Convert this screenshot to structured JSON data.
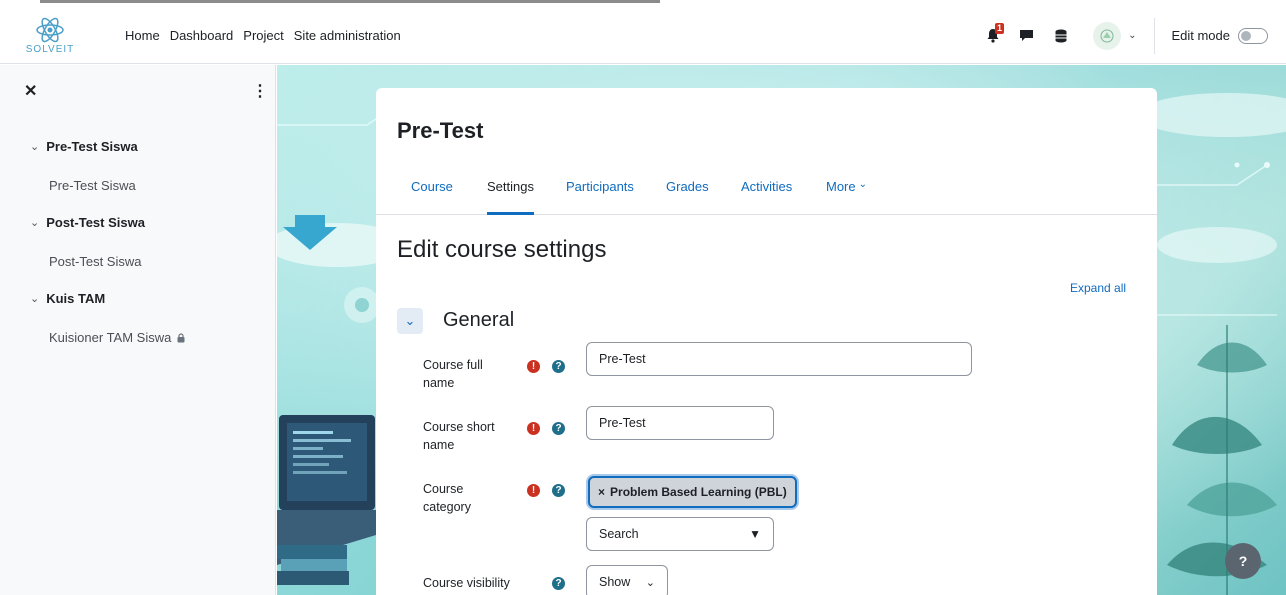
{
  "brand": {
    "logo_text": "SOLVEIT"
  },
  "nav": {
    "items": [
      "Home",
      "Dashboard",
      "Project",
      "Site administration"
    ],
    "notification_count": "1",
    "edit_mode_label": "Edit mode"
  },
  "drawer": {
    "close_icon": "✕",
    "menu_icon": "⋮",
    "sections": [
      {
        "title": "Pre-Test Siswa",
        "items": [
          {
            "label": "Pre-Test Siswa",
            "locked": false
          }
        ]
      },
      {
        "title": "Post-Test Siswa",
        "items": [
          {
            "label": "Post-Test Siswa",
            "locked": false
          }
        ]
      },
      {
        "title": "Kuis TAM",
        "items": [
          {
            "label": "Kuisioner TAM Siswa",
            "locked": true
          }
        ]
      }
    ]
  },
  "course": {
    "title": "Pre-Test",
    "tabs": [
      "Course",
      "Settings",
      "Participants",
      "Grades",
      "Activities",
      "More"
    ],
    "active_tab": "Settings"
  },
  "page": {
    "heading": "Edit course settings",
    "expand_all": "Expand all",
    "section_title": "General",
    "fields": {
      "full_name": {
        "label_line1": "Course full",
        "label_line2": "name",
        "value": "Pre-Test"
      },
      "short_name": {
        "label_line1": "Course short",
        "label_line2": "name",
        "value": "Pre-Test"
      },
      "category": {
        "label_line1": "Course",
        "label_line2": "category",
        "tag": "Problem Based Learning (PBL)",
        "tag_remove": "×",
        "search_placeholder": "Search"
      },
      "visibility": {
        "label": "Course visibility",
        "value": "Show"
      }
    },
    "help_fab": "?"
  },
  "colors": {
    "accent": "#0f6cbf",
    "required": "#ca3120",
    "help": "#1f6f8b"
  }
}
